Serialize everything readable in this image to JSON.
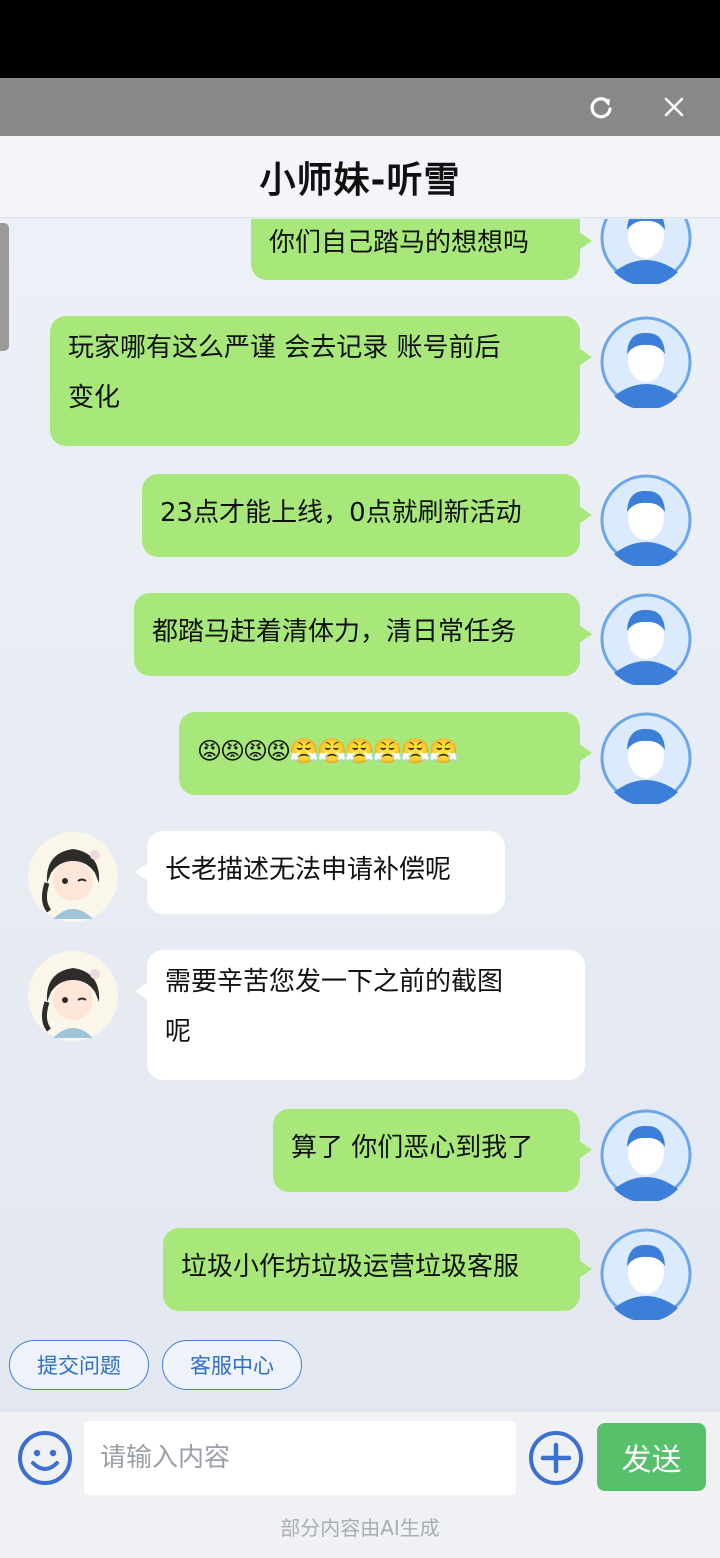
{
  "header": {
    "title": "小师妹-听雪"
  },
  "messages": [
    {
      "from": "user",
      "text": "你们自己踏马的想想吗"
    },
    {
      "from": "user",
      "text": "玩家哪有这么严谨 会去记录 账号前后变化",
      "line1": "玩家哪有这么严谨 会去记录 账号前后",
      "line2": "变化"
    },
    {
      "from": "user",
      "text": "23点才能上线，0点就刷新活动"
    },
    {
      "from": "user",
      "text": "都踏马赶着清体力，清日常任务"
    },
    {
      "from": "user",
      "text": "😡😡😡😡😤😤😤😤😤😤"
    },
    {
      "from": "agent",
      "text": "长老描述无法申请补偿呢"
    },
    {
      "from": "agent",
      "text": "需要辛苦您发一下之前的截图呢",
      "line1": "需要辛苦您发一下之前的截图",
      "line2": "呢"
    },
    {
      "from": "user",
      "text": "算了 你们恶心到我了"
    },
    {
      "from": "user",
      "text": "垃圾小作坊垃圾运营垃圾客服"
    }
  ],
  "quick_actions": [
    "提交问题",
    "客服中心"
  ],
  "input": {
    "placeholder": "请输入内容",
    "send_label": "发送"
  },
  "footnote": "部分内容由AI生成",
  "colors": {
    "user_bubble": "#a8e87a",
    "agent_bubble": "#ffffff",
    "send": "#56c16a",
    "chip": "#3d7fd6"
  }
}
